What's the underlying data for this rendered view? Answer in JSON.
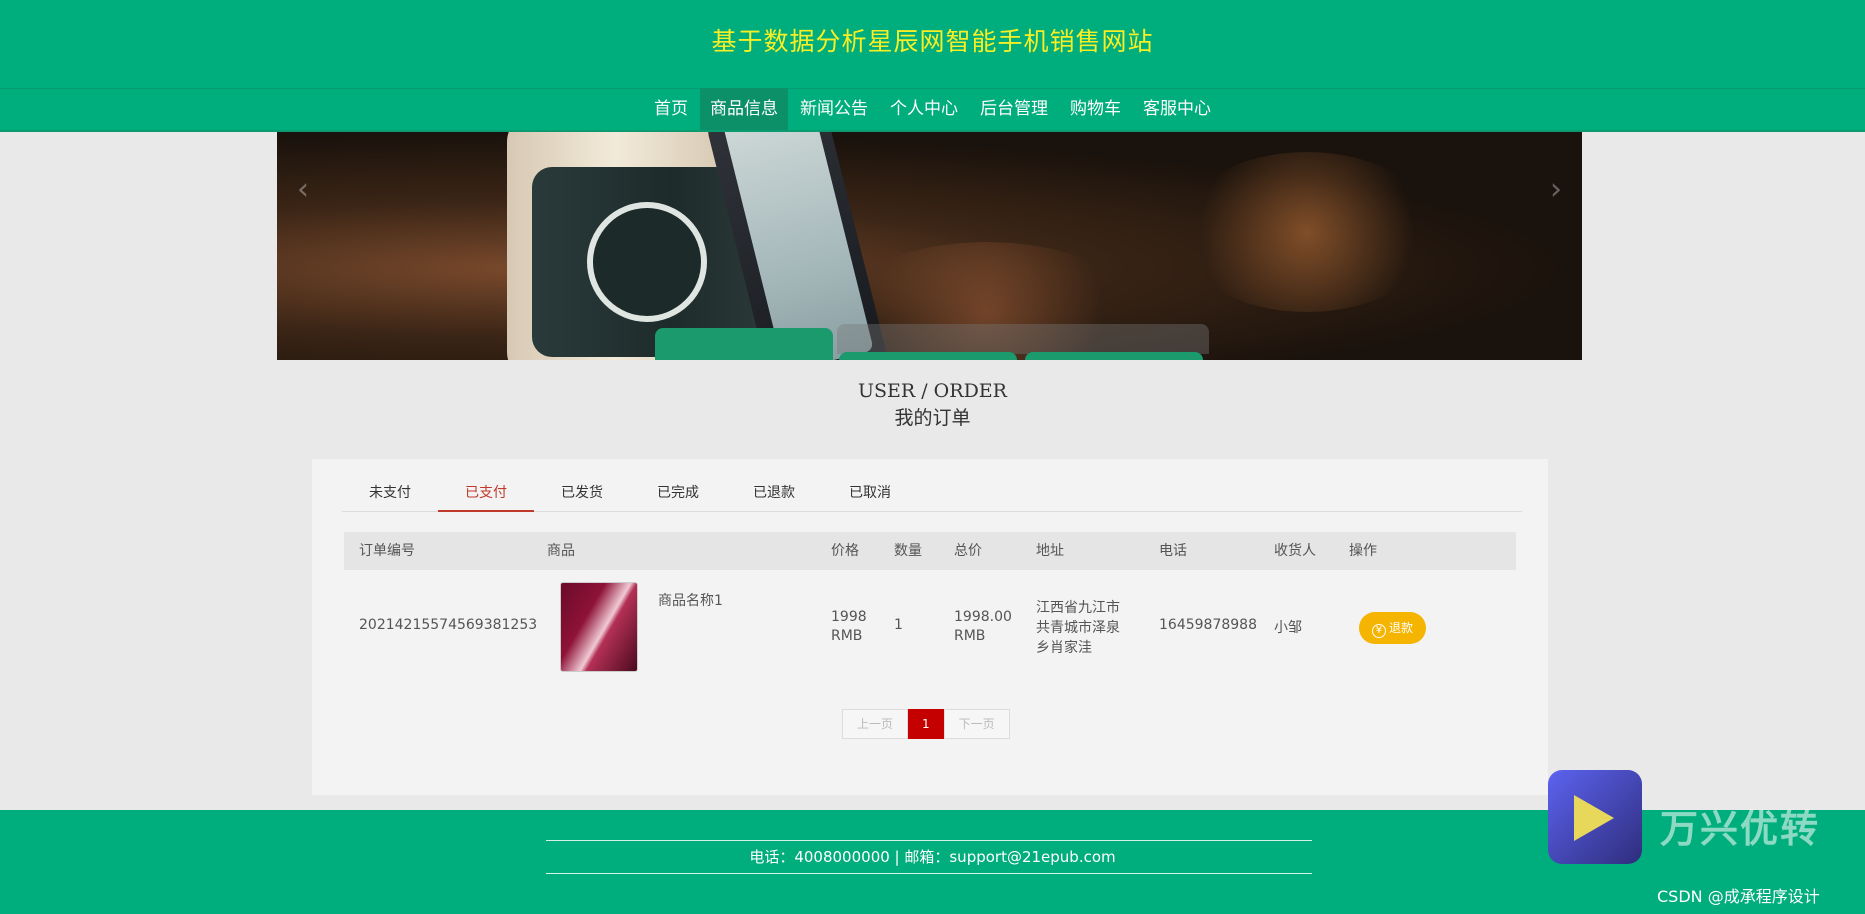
{
  "header": {
    "site_title": "基于数据分析星辰网智能手机销售网站",
    "nav": [
      "首页",
      "商品信息",
      "新闻公告",
      "个人中心",
      "后台管理",
      "购物车",
      "客服中心"
    ],
    "active_nav": "商品信息"
  },
  "banner": {
    "prev": "‹",
    "next": "›"
  },
  "heading": {
    "en": "USER / ORDER",
    "cn": "我的订单"
  },
  "orders": {
    "tabs": [
      "未支付",
      "已支付",
      "已发货",
      "已完成",
      "已退款",
      "已取消"
    ],
    "active_tab": "已支付",
    "columns": [
      "订单编号",
      "商品",
      "价格",
      "数量",
      "总价",
      "地址",
      "电话",
      "收货人",
      "操作"
    ],
    "row": {
      "order_no": "20214215574569381253",
      "product_name": "商品名称1",
      "price": "1998 RMB",
      "quantity": "1",
      "total": "1998.00 RMB",
      "address": "江西省九江市共青城市泽泉乡肖家洼",
      "phone": "16459878988",
      "receiver": "小邹",
      "action": "退款",
      "action_icon": "yen-icon"
    },
    "pager": {
      "prev": "上一页",
      "current": "1",
      "next": "下一页"
    }
  },
  "footer": {
    "contact": "电话：4008000000 | 邮箱：support@21epub.com"
  },
  "watermark": {
    "brand": "万兴优转",
    "credit": "CSDN @成承程序设计"
  },
  "colors": {
    "primary": "#00ad7c",
    "title": "#f7ef25",
    "accent_red": "#c40000",
    "refund_btn": "#f5b400"
  }
}
